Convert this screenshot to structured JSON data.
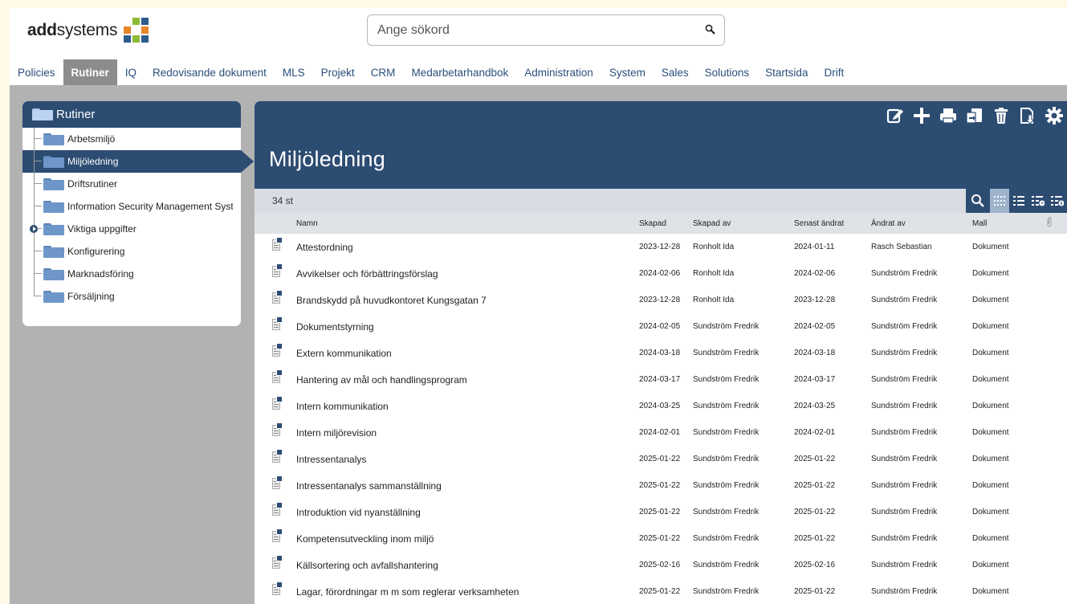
{
  "brand": {
    "name_bold": "add",
    "name_rest": "systems",
    "colors": [
      "#e8862a",
      "#2f5b8c",
      "#8bbb38",
      "#2f5b8c"
    ]
  },
  "search": {
    "placeholder": "Ange sökord",
    "icon": "search-icon"
  },
  "nav": {
    "tabs": [
      {
        "label": "Policies"
      },
      {
        "label": "Rutiner",
        "active": true
      },
      {
        "label": "IQ"
      },
      {
        "label": "Redovisande dokument"
      },
      {
        "label": "MLS"
      },
      {
        "label": "Projekt"
      },
      {
        "label": "CRM"
      },
      {
        "label": "Medarbetarhandbok"
      },
      {
        "label": "Administration"
      },
      {
        "label": "System"
      },
      {
        "label": "Sales"
      },
      {
        "label": "Solutions"
      },
      {
        "label": "Startsida"
      },
      {
        "label": "Drift"
      }
    ]
  },
  "tree": {
    "root": "Rutiner",
    "items": [
      {
        "label": "Arbetsmiljö"
      },
      {
        "label": "Miljöledning",
        "active": true
      },
      {
        "label": "Driftsrutiner"
      },
      {
        "label": "Information Security Management System",
        "clip": true
      },
      {
        "label": "Viktiga uppgifter",
        "expandable": true
      },
      {
        "label": "Konfigurering"
      },
      {
        "label": "Marknadsföring"
      },
      {
        "label": "Försäljning"
      }
    ]
  },
  "toolbar": {
    "icons": [
      "edit-icon",
      "add-icon",
      "print-icon",
      "move-icon",
      "delete-icon",
      "export-icon",
      "settings-icon"
    ]
  },
  "main": {
    "title": "Miljöledning",
    "count": "34 st",
    "view_icons": [
      "search-icon",
      "grid-view-icon",
      "list-view-icon",
      "filter-list-icon",
      "info-list-icon"
    ]
  },
  "table": {
    "headers": {
      "name": "Namn",
      "created": "Skapad",
      "created_by": "Skapad av",
      "modified": "Senast ändrat",
      "modified_by": "Ändrat av",
      "template": "Mall"
    },
    "rows": [
      {
        "name": "Attestordning",
        "created": "2023-12-28",
        "created_by": "Ronholt Ida",
        "modified": "2024-01-11",
        "modified_by": "Rasch Sebastian",
        "template": "Dokument"
      },
      {
        "name": "Avvikelser och förbättringsförslag",
        "created": "2024-02-06",
        "created_by": "Ronholt Ida",
        "modified": "2024-02-06",
        "modified_by": "Sundström Fredrik",
        "template": "Dokument"
      },
      {
        "name": "Brandskydd på huvudkontoret Kungsgatan 7",
        "created": "2023-12-28",
        "created_by": "Ronholt Ida",
        "modified": "2023-12-28",
        "modified_by": "Sundström Fredrik",
        "template": "Dokument"
      },
      {
        "name": "Dokumentstyrning",
        "created": "2024-02-05",
        "created_by": "Sundström Fredrik",
        "modified": "2024-02-05",
        "modified_by": "Sundström Fredrik",
        "template": "Dokument"
      },
      {
        "name": "Extern kommunikation",
        "created": "2024-03-18",
        "created_by": "Sundström Fredrik",
        "modified": "2024-03-18",
        "modified_by": "Sundström Fredrik",
        "template": "Dokument"
      },
      {
        "name": "Hantering av mål och handlingsprogram",
        "created": "2024-03-17",
        "created_by": "Sundström Fredrik",
        "modified": "2024-03-17",
        "modified_by": "Sundström Fredrik",
        "template": "Dokument"
      },
      {
        "name": "Intern kommunikation",
        "created": "2024-03-25",
        "created_by": "Sundström Fredrik",
        "modified": "2024-03-25",
        "modified_by": "Sundström Fredrik",
        "template": "Dokument"
      },
      {
        "name": "Intern miljörevision",
        "created": "2024-02-01",
        "created_by": "Sundström Fredrik",
        "modified": "2024-02-01",
        "modified_by": "Sundström Fredrik",
        "template": "Dokument"
      },
      {
        "name": "Intressentanalys",
        "created": "2025-01-22",
        "created_by": "Sundström Fredrik",
        "modified": "2025-01-22",
        "modified_by": "Sundström Fredrik",
        "template": "Dokument"
      },
      {
        "name": "Intressentanalys sammanställning",
        "created": "2025-01-22",
        "created_by": "Sundström Fredrik",
        "modified": "2025-01-22",
        "modified_by": "Sundström Fredrik",
        "template": "Dokument"
      },
      {
        "name": "Introduktion vid nyanställning",
        "created": "2025-01-22",
        "created_by": "Sundström Fredrik",
        "modified": "2025-01-22",
        "modified_by": "Sundström Fredrik",
        "template": "Dokument"
      },
      {
        "name": "Kompetensutveckling inom miljö",
        "created": "2025-01-22",
        "created_by": "Sundström Fredrik",
        "modified": "2025-01-22",
        "modified_by": "Sundström Fredrik",
        "template": "Dokument"
      },
      {
        "name": "Källsortering och avfallshantering",
        "created": "2025-02-16",
        "created_by": "Sundström Fredrik",
        "modified": "2025-02-16",
        "modified_by": "Sundström Fredrik",
        "template": "Dokument"
      },
      {
        "name": "Lagar, förordningar m m som reglerar verksamheten",
        "created": "2025-01-22",
        "created_by": "Sundström Fredrik",
        "modified": "2025-01-22",
        "modified_by": "Sundström Fredrik",
        "template": "Dokument"
      }
    ]
  },
  "theme": {
    "primary": "#2d4c72",
    "nav_active": "#8c8c8c",
    "backdrop": "#b2b2b2",
    "link": "#2a4f7a"
  }
}
